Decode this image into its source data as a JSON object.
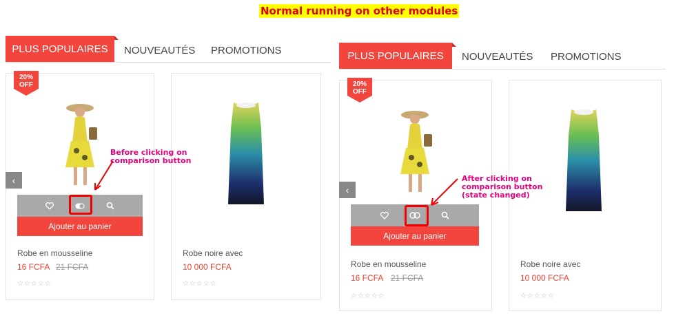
{
  "headline": "Normal running on other modules",
  "tabs": [
    "PLUS POPULAIRES",
    "NOUVEAUTÉS",
    "PROMOTIONS"
  ],
  "badge": [
    "20%",
    "OFF"
  ],
  "cart_label": "Ajouter au panier",
  "products": [
    {
      "name": "Robe en mousseline",
      "price": "16 FCFA",
      "old_price": "21 FCFA"
    },
    {
      "name": "Robe noire avec",
      "price": "10 000 FCFA"
    }
  ],
  "stars": "☆☆☆☆☆",
  "prev_arrow": "‹",
  "annotations": {
    "before": [
      "Before clicking on",
      "comparison button"
    ],
    "after": [
      "After clicking on",
      "comparison button",
      "(state changed)"
    ]
  },
  "colors": {
    "accent": "#f1453d",
    "note": "#e6007e",
    "highlight": "#e00000",
    "action_bar": "#a9a9a9"
  },
  "icons": [
    "heart-icon",
    "compare-toggle-icon",
    "magnify-icon",
    "chevron-left-icon"
  ]
}
